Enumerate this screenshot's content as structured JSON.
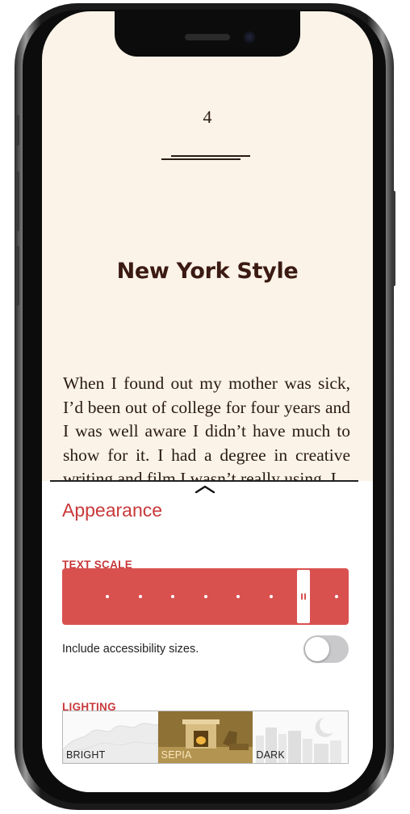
{
  "book": {
    "chapter_number": "4",
    "chapter_title": "New York Style",
    "body": "When I found out my mother was sick, I’d been out of college for four years and I was well aware I didn’t have much to show for it. I had a degree in creative writing and film I wasn’t really using. I"
  },
  "panel": {
    "title": "Appearance",
    "text_scale": {
      "label": "TEXT SCALE",
      "steps": 8,
      "selected_step": 6
    },
    "accessibility": {
      "label": "Include accessibility sizes.",
      "enabled": false
    },
    "lighting": {
      "label": "LIGHTING",
      "options": [
        {
          "label": "BRIGHT"
        },
        {
          "label": "SEPIA"
        },
        {
          "label": "DARK"
        }
      ],
      "selected": "SEPIA"
    }
  },
  "colors": {
    "accent": "#c8393b",
    "scale_bar": "#d9514f",
    "page_background": "#fbf3e8",
    "sepia_swatch": "#9a7c3c"
  },
  "icons": {
    "collapse": "chevron-up-icon"
  }
}
